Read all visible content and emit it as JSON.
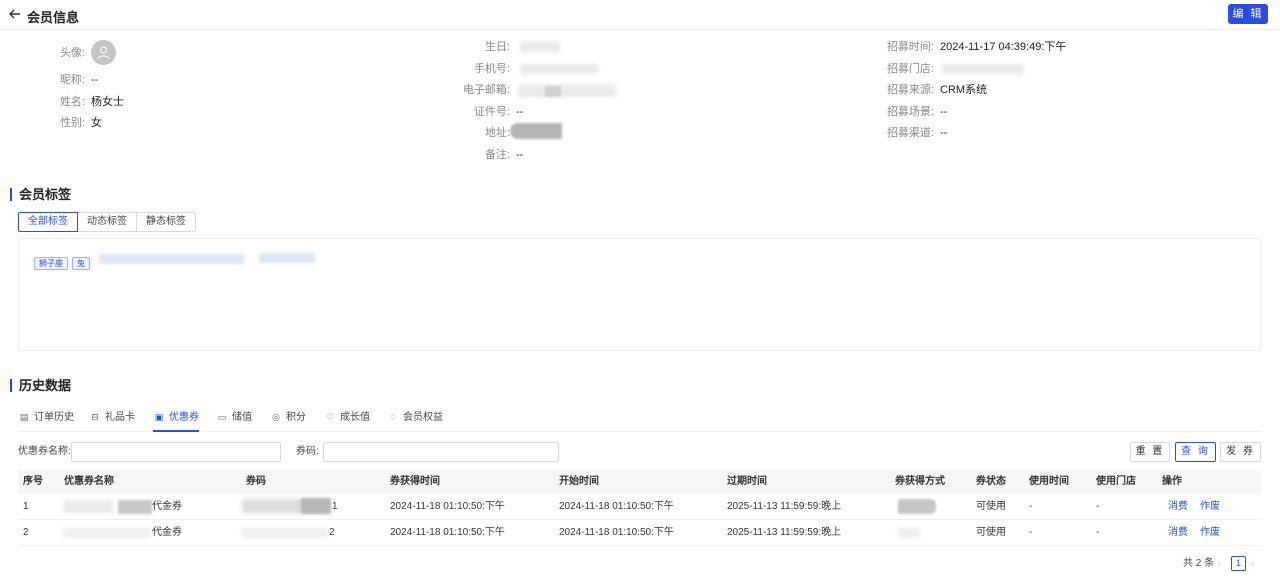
{
  "header": {
    "title": "会员信息",
    "edit_label": "编 辑"
  },
  "profile": {
    "col1": [
      {
        "label": "头像:",
        "value": ""
      },
      {
        "label": "昵称:",
        "value": "--"
      },
      {
        "label": "姓名:",
        "value": "杨女士"
      },
      {
        "label": "性别:",
        "value": "女"
      }
    ],
    "col2": [
      {
        "label": "生日:",
        "value": ""
      },
      {
        "label": "手机号:",
        "value": ""
      },
      {
        "label": "电子邮箱:",
        "value": ""
      },
      {
        "label": "证件号:",
        "value": "--"
      },
      {
        "label": "地址:",
        "value": ""
      },
      {
        "label": "备注:",
        "value": "--"
      }
    ],
    "col3": [
      {
        "label": "招募时间:",
        "value": "2024-11-17 04:39:49:下午"
      },
      {
        "label": "招募门店:",
        "value": ""
      },
      {
        "label": "招募来源:",
        "value": "CRM系统"
      },
      {
        "label": "招募场景:",
        "value": "--"
      },
      {
        "label": "招募渠道:",
        "value": "--"
      }
    ]
  },
  "tags_section": {
    "title": "会员标签",
    "tabs": [
      "全部标签",
      "动态标签",
      "静态标签"
    ],
    "chips": [
      "狮子座",
      "兔"
    ]
  },
  "history": {
    "title": "历史数据",
    "tabs": [
      {
        "label": "订单历史",
        "icon": "order-icon"
      },
      {
        "label": "礼品卡",
        "icon": "gift-icon"
      },
      {
        "label": "优惠券",
        "icon": "coupon-icon"
      },
      {
        "label": "储值",
        "icon": "wallet-icon"
      },
      {
        "label": "积分",
        "icon": "points-icon"
      },
      {
        "label": "成长值",
        "icon": "growth-icon"
      },
      {
        "label": "会员权益",
        "icon": "benefit-icon"
      }
    ],
    "filters": {
      "coupon_name_label": "优惠券名称:",
      "coupon_code_label": "券码:"
    },
    "buttons": {
      "reset": "重 置",
      "query": "查 询",
      "issue": "发 券"
    },
    "table": {
      "headers": [
        "序号",
        "优惠券名称",
        "券码",
        "券获得时间",
        "开始时间",
        "过期时间",
        "券获得方式",
        "券状态",
        "使用时间",
        "使用门店",
        "操作"
      ],
      "rows": [
        {
          "no": "1",
          "name": "代金券",
          "code": "1",
          "got": "2024-11-18 01:10:50:下午",
          "start": "2024-11-18 01:10:50:下午",
          "expire": "2025-11-13 11:59:59:晚上",
          "method": "",
          "status": "可使用",
          "use_time": "-",
          "use_store": "-",
          "op1": "消费",
          "op2": "作废"
        },
        {
          "no": "2",
          "name": "代金券",
          "code": "2",
          "got": "2024-11-18 01:10:50:下午",
          "start": "2024-11-18 01:10:50:下午",
          "expire": "2025-11-13 11:59:59:晚上",
          "method": "",
          "status": "可使用",
          "use_time": "-",
          "use_store": "-",
          "op1": "消费",
          "op2": "作废"
        }
      ]
    },
    "pager": {
      "total": "共 2 条",
      "prev": "‹",
      "page": "1",
      "next": "›"
    }
  },
  "colors": {
    "accent": "#2b4ce0"
  }
}
